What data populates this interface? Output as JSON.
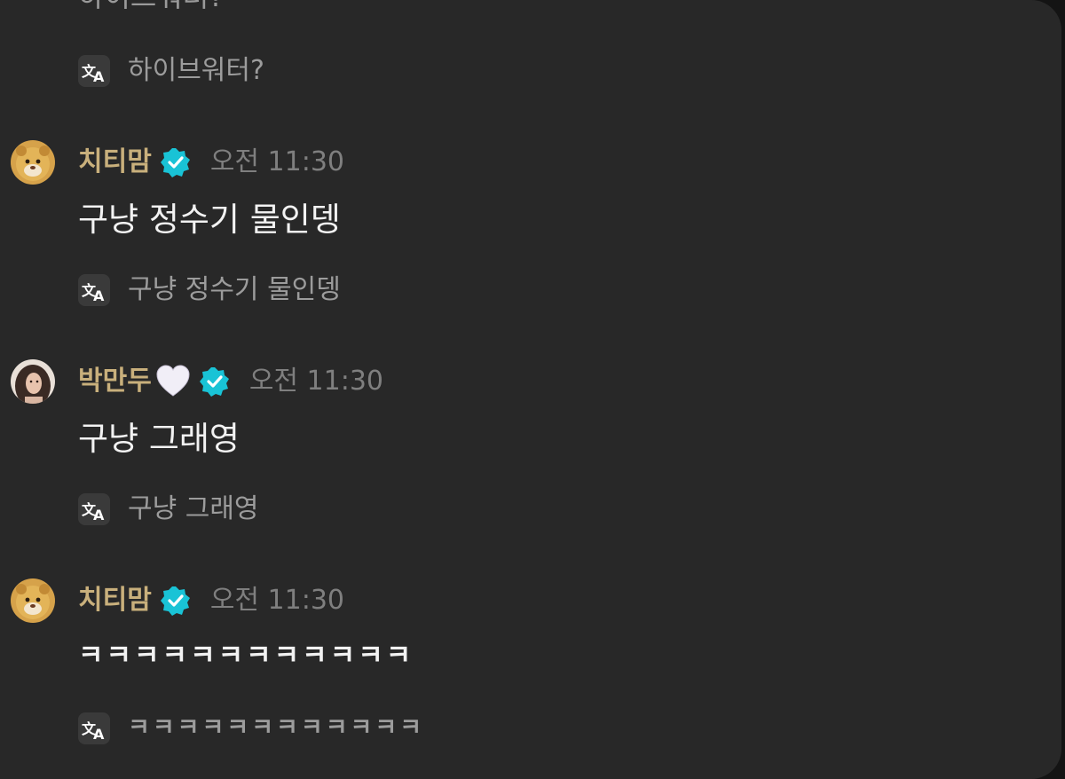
{
  "prev_message": {
    "cut_text": "하이브워터?",
    "translation": "하이브워터?"
  },
  "messages": [
    {
      "user": "치티맘",
      "time": "오전 11:30",
      "text": "구냥 정수기 물인뎅",
      "translation": "구냥 정수기 물인뎅"
    },
    {
      "user": "박만두",
      "time": "오전 11:30",
      "text": "구냥 그래영",
      "translation": "구냥 그래영"
    },
    {
      "user": "치티맘",
      "time": "오전 11:30",
      "text": "ㅋㅋㅋㅋㅋㅋㅋㅋㅋㅋㅋㅋ",
      "translation": "ㅋㅋㅋㅋㅋㅋㅋㅋㅋㅋㅋㅋ"
    }
  ],
  "icons": {
    "translate": "translate-icon",
    "verified": "verified-badge-icon",
    "heart": "white-heart-emoji"
  },
  "colors": {
    "background": "#282828",
    "username": "#c9b07c",
    "verified": "#19c3d6",
    "message_text": "#f2f2f2",
    "secondary_text": "#9c9c9c"
  }
}
